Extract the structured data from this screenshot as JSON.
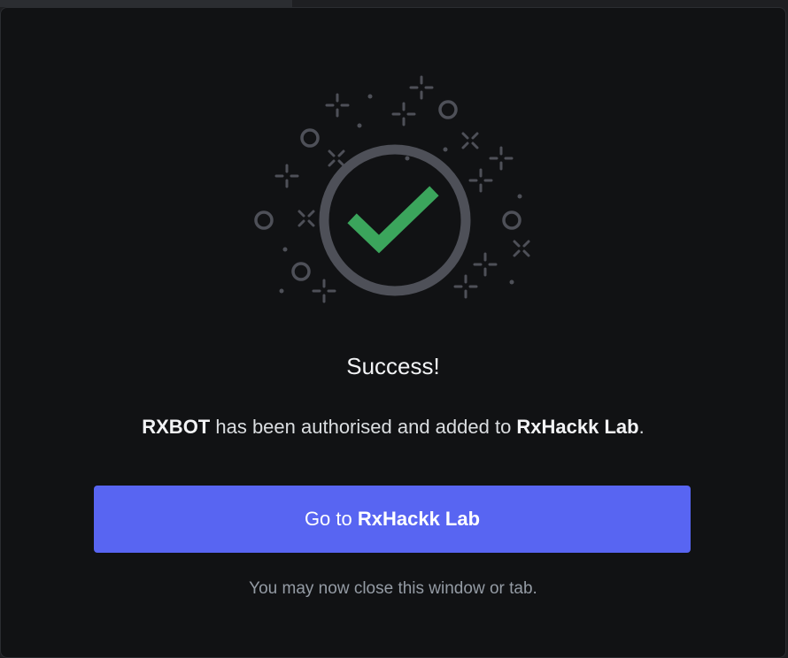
{
  "title": "Success!",
  "message": {
    "bot_name": "RXBOT",
    "middle_text": " has been authorised and added to ",
    "server_name": "RxHackk Lab",
    "end_text": "."
  },
  "button": {
    "prefix": "Go to ",
    "server_name": "RxHackk Lab"
  },
  "note": "You may now close this window or tab.",
  "colors": {
    "background": "#111214",
    "accent": "#5865f2",
    "success": "#3ba55c"
  },
  "icons": {
    "illustration": "success-check-icon"
  }
}
